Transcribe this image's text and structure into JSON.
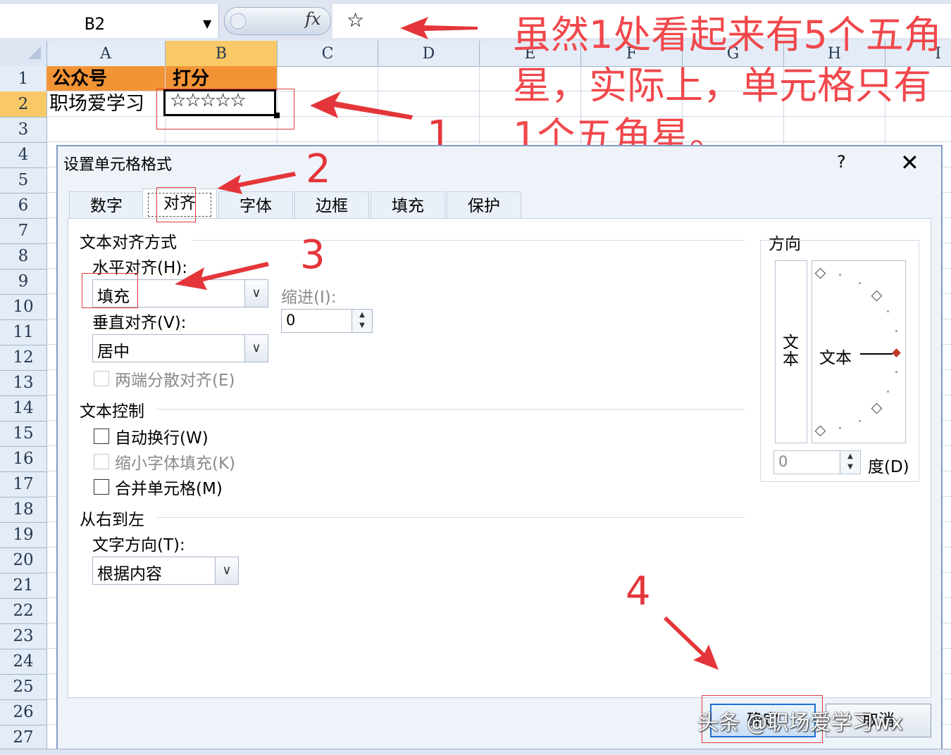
{
  "formula_bar": {
    "name_box": "B2",
    "fx_label": "fx",
    "formula_value": "☆"
  },
  "columns": [
    "A",
    "B",
    "C",
    "D",
    "E",
    "F",
    "G",
    "H",
    "I"
  ],
  "rows": [
    "1",
    "2",
    "3",
    "4",
    "5",
    "6",
    "7",
    "8",
    "9",
    "10",
    "11",
    "12",
    "13",
    "14",
    "15",
    "16",
    "17",
    "18",
    "19",
    "20",
    "21",
    "22",
    "23",
    "24",
    "25",
    "26",
    "27"
  ],
  "cells": {
    "A1": "公众号",
    "B1": "打分",
    "A2": "职场爱学习",
    "B2": "☆☆☆☆☆"
  },
  "annotations": {
    "note": "虽然1处看起来有5个五角星，实际上，单元格只有1个五角星。",
    "num1": "1",
    "num2": "2",
    "num3": "3",
    "num4": "4"
  },
  "dialog": {
    "title": "设置单元格格式",
    "help": "?",
    "close": "✕",
    "tabs": [
      "数字",
      "对齐",
      "字体",
      "边框",
      "填充",
      "保护"
    ],
    "active_tab": "对齐",
    "text_alignment_section": "文本对齐方式",
    "horizontal_label": "水平对齐(H):",
    "horizontal_value": "填充",
    "indent_label": "缩进(I):",
    "indent_value": "0",
    "vertical_label": "垂直对齐(V):",
    "vertical_value": "居中",
    "justify_distributed_label": "两端分散对齐(E)",
    "text_control_section": "文本控制",
    "wrap_text_label": "自动换行(W)",
    "shrink_to_fit_label": "缩小字体填充(K)",
    "merge_cells_label": "合并单元格(M)",
    "rtl_section": "从右到左",
    "text_direction_label": "文字方向(T):",
    "text_direction_value": "根据内容",
    "orientation_section": "方向",
    "vertical_text": "文本",
    "dial_text": "文本",
    "degrees_value": "0",
    "degrees_label": "度(D)",
    "ok_label": "确定",
    "cancel_label": "取消"
  },
  "watermark": "头条 @职场爱学习wx",
  "colors": {
    "header_orange": "#f29436",
    "selected_header": "#f9c967",
    "annotation_red": "#e4363a"
  }
}
